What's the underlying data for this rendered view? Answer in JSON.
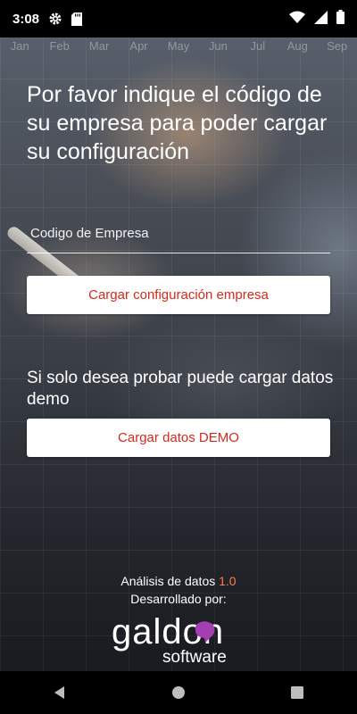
{
  "status_bar": {
    "time": "3:08"
  },
  "background": {
    "months": [
      "Jan",
      "Feb",
      "Mar",
      "Apr",
      "May",
      "Jun",
      "Jul",
      "Aug",
      "Sep"
    ]
  },
  "main": {
    "title": "Por favor indique el código de su empresa para poder cargar su configuración",
    "company_code_placeholder": "Codigo de Empresa",
    "company_code_value": "",
    "load_config_label": "Cargar configuración empresa",
    "demo_text": "Si solo desea probar puede cargar datos demo",
    "load_demo_label": "Cargar datos DEMO"
  },
  "footer": {
    "app_name": "Análisis de datos",
    "version": "1.0",
    "developed_by": "Desarrollado por:",
    "logo_word": "galdon",
    "logo_sub": "software"
  },
  "colors": {
    "accent": "#d6291b",
    "version": "#ff7d4a",
    "logo_dot": "#a33fb2"
  }
}
